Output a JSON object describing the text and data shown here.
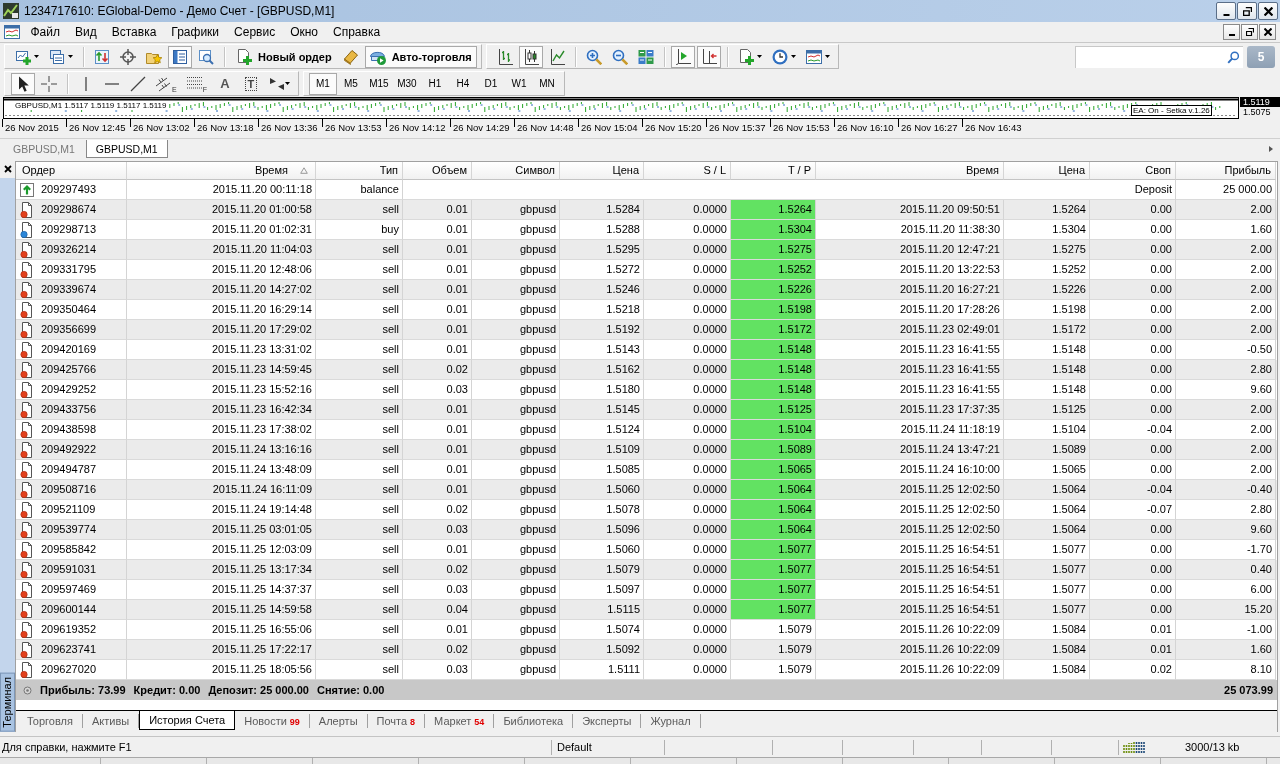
{
  "window": {
    "title": "1234717610: EGlobal-Demo - Демо Счет - [GBPUSD,M1]"
  },
  "menu": [
    "Файл",
    "Вид",
    "Вставка",
    "Графики",
    "Сервис",
    "Окно",
    "Справка"
  ],
  "toolbars": [
    {
      "groups": [
        [
          {
            "pressed": false
          },
          {
            "pressed": false
          }
        ],
        [
          {
            "pressed": false
          },
          {
            "pressed": false
          },
          {
            "pressed": false
          },
          {
            "pressed": true
          },
          {
            "pressed": false
          }
        ],
        [
          {
            "label": "Новый ордер",
            "pressed": false
          },
          {
            "pressed": false
          },
          {
            "label": "Авто-торговля",
            "pressed": true
          }
        ]
      ]
    },
    {
      "groups": [
        [
          {
            "pressed": false
          },
          {
            "pressed": true
          },
          {
            "pressed": false
          }
        ],
        [
          {
            "pressed": false
          },
          {
            "pressed": false
          },
          {
            "pressed": false
          }
        ],
        [
          {
            "pressed": true
          },
          {
            "pressed": true
          }
        ],
        [
          {
            "pressed": false
          },
          {
            "pressed": false
          },
          {
            "pressed": false
          }
        ]
      ]
    }
  ],
  "search": {
    "messages_count": "5"
  },
  "drawing_tools": {
    "groups": [
      [
        {
          "pressed": true
        },
        {
          "pressed": false
        }
      ],
      [
        {
          "pressed": false
        },
        {
          "pressed": false
        },
        {
          "pressed": false
        },
        {
          "label": "E",
          "pressed": false
        },
        {
          "label": "F",
          "pressed": false
        },
        {
          "label": "A",
          "pressed": false
        },
        {
          "label": "T",
          "pressed": false
        },
        {
          "pressed": false
        }
      ]
    ]
  },
  "timeframes": [
    {
      "label": "M1",
      "selected": true
    },
    {
      "label": "M5",
      "selected": false
    },
    {
      "label": "M15",
      "selected": false
    },
    {
      "label": "M30",
      "selected": false
    },
    {
      "label": "H1",
      "selected": false
    },
    {
      "label": "H4",
      "selected": false
    },
    {
      "label": "D1",
      "selected": false
    },
    {
      "label": "W1",
      "selected": false
    },
    {
      "label": "MN",
      "selected": false
    }
  ],
  "chart": {
    "header": "GBPUSD,M1  1.5117 1.5119 1.5117 1.5119",
    "ea_label": "EA: On - Setka v.1.26",
    "price_labels": [
      {
        "text": "1.5119",
        "current": true
      },
      {
        "text": "1.5075",
        "current": false
      }
    ],
    "time_labels": [
      "26 Nov 2015",
      "26 Nov 12:45",
      "26 Nov 13:02",
      "26 Nov 13:18",
      "26 Nov 13:36",
      "26 Nov 13:53",
      "26 Nov 14:12",
      "26 Nov 14:29",
      "26 Nov 14:48",
      "26 Nov 15:04",
      "26 Nov 15:20",
      "26 Nov 15:37",
      "26 Nov 15:53",
      "26 Nov 16:10",
      "26 Nov 16:27",
      "26 Nov 16:43"
    ]
  },
  "chart_tabs": [
    {
      "label": "GBPUSD,M1",
      "selected": false
    },
    {
      "label": "GBPUSD,M1",
      "selected": true
    }
  ],
  "terminal": {
    "label": "Терминал",
    "columns": [
      {
        "label": "Ордер",
        "sorted": false
      },
      {
        "label": "Время",
        "sorted": true
      },
      {
        "label": "Тип",
        "sorted": false
      },
      {
        "label": "Объем",
        "sorted": false
      },
      {
        "label": "Символ",
        "sorted": false
      },
      {
        "label": "Цена",
        "sorted": false
      },
      {
        "label": "S / L",
        "sorted": false
      },
      {
        "label": "T / P",
        "sorted": false
      },
      {
        "label": "Время",
        "sorted": false
      },
      {
        "label": "Цена",
        "sorted": false
      },
      {
        "label": "Своп",
        "sorted": false
      },
      {
        "label": "Прибыль",
        "sorted": false
      }
    ],
    "rows": [
      {
        "kind": "balance",
        "order": "209297493",
        "time": "2015.11.20 00:11:18",
        "type": "balance",
        "comment": "Deposit",
        "profit": "25 000.00"
      },
      {
        "kind": "sell",
        "order": "209298674",
        "time": "2015.11.20 01:00:58",
        "type": "sell",
        "volume": "0.01",
        "symbol": "gbpusd",
        "price": "1.5284",
        "sl": "0.0000",
        "tp": "1.5264",
        "tp_highlight": true,
        "close_time": "2015.11.20 09:50:51",
        "close_price": "1.5264",
        "swap": "0.00",
        "profit": "2.00"
      },
      {
        "kind": "buy",
        "order": "209298713",
        "time": "2015.11.20 01:02:31",
        "type": "buy",
        "volume": "0.01",
        "symbol": "gbpusd",
        "price": "1.5288",
        "sl": "0.0000",
        "tp": "1.5304",
        "tp_highlight": true,
        "close_time": "2015.11.20 11:38:30",
        "close_price": "1.5304",
        "swap": "0.00",
        "profit": "1.60"
      },
      {
        "kind": "sell",
        "order": "209326214",
        "time": "2015.11.20 11:04:03",
        "type": "sell",
        "volume": "0.01",
        "symbol": "gbpusd",
        "price": "1.5295",
        "sl": "0.0000",
        "tp": "1.5275",
        "tp_highlight": true,
        "close_time": "2015.11.20 12:47:21",
        "close_price": "1.5275",
        "swap": "0.00",
        "profit": "2.00"
      },
      {
        "kind": "sell",
        "order": "209331795",
        "time": "2015.11.20 12:48:06",
        "type": "sell",
        "volume": "0.01",
        "symbol": "gbpusd",
        "price": "1.5272",
        "sl": "0.0000",
        "tp": "1.5252",
        "tp_highlight": true,
        "close_time": "2015.11.20 13:22:53",
        "close_price": "1.5252",
        "swap": "0.00",
        "profit": "2.00"
      },
      {
        "kind": "sell",
        "order": "209339674",
        "time": "2015.11.20 14:27:02",
        "type": "sell",
        "volume": "0.01",
        "symbol": "gbpusd",
        "price": "1.5246",
        "sl": "0.0000",
        "tp": "1.5226",
        "tp_highlight": true,
        "close_time": "2015.11.20 16:27:21",
        "close_price": "1.5226",
        "swap": "0.00",
        "profit": "2.00"
      },
      {
        "kind": "sell",
        "order": "209350464",
        "time": "2015.11.20 16:29:14",
        "type": "sell",
        "volume": "0.01",
        "symbol": "gbpusd",
        "price": "1.5218",
        "sl": "0.0000",
        "tp": "1.5198",
        "tp_highlight": true,
        "close_time": "2015.11.20 17:28:26",
        "close_price": "1.5198",
        "swap": "0.00",
        "profit": "2.00"
      },
      {
        "kind": "sell",
        "order": "209356699",
        "time": "2015.11.20 17:29:02",
        "type": "sell",
        "volume": "0.01",
        "symbol": "gbpusd",
        "price": "1.5192",
        "sl": "0.0000",
        "tp": "1.5172",
        "tp_highlight": true,
        "close_time": "2015.11.23 02:49:01",
        "close_price": "1.5172",
        "swap": "0.00",
        "profit": "2.00"
      },
      {
        "kind": "sell",
        "order": "209420169",
        "time": "2015.11.23 13:31:02",
        "type": "sell",
        "volume": "0.01",
        "symbol": "gbpusd",
        "price": "1.5143",
        "sl": "0.0000",
        "tp": "1.5148",
        "tp_highlight": true,
        "close_time": "2015.11.23 16:41:55",
        "close_price": "1.5148",
        "swap": "0.00",
        "profit": "-0.50"
      },
      {
        "kind": "sell",
        "order": "209425766",
        "time": "2015.11.23 14:59:45",
        "type": "sell",
        "volume": "0.02",
        "symbol": "gbpusd",
        "price": "1.5162",
        "sl": "0.0000",
        "tp": "1.5148",
        "tp_highlight": true,
        "close_time": "2015.11.23 16:41:55",
        "close_price": "1.5148",
        "swap": "0.00",
        "profit": "2.80"
      },
      {
        "kind": "sell",
        "order": "209429252",
        "time": "2015.11.23 15:52:16",
        "type": "sell",
        "volume": "0.03",
        "symbol": "gbpusd",
        "price": "1.5180",
        "sl": "0.0000",
        "tp": "1.5148",
        "tp_highlight": true,
        "close_time": "2015.11.23 16:41:55",
        "close_price": "1.5148",
        "swap": "0.00",
        "profit": "9.60"
      },
      {
        "kind": "sell",
        "order": "209433756",
        "time": "2015.11.23 16:42:34",
        "type": "sell",
        "volume": "0.01",
        "symbol": "gbpusd",
        "price": "1.5145",
        "sl": "0.0000",
        "tp": "1.5125",
        "tp_highlight": true,
        "close_time": "2015.11.23 17:37:35",
        "close_price": "1.5125",
        "swap": "0.00",
        "profit": "2.00"
      },
      {
        "kind": "sell",
        "order": "209438598",
        "time": "2015.11.23 17:38:02",
        "type": "sell",
        "volume": "0.01",
        "symbol": "gbpusd",
        "price": "1.5124",
        "sl": "0.0000",
        "tp": "1.5104",
        "tp_highlight": true,
        "close_time": "2015.11.24 11:18:19",
        "close_price": "1.5104",
        "swap": "-0.04",
        "profit": "2.00"
      },
      {
        "kind": "sell",
        "order": "209492922",
        "time": "2015.11.24 13:16:16",
        "type": "sell",
        "volume": "0.01",
        "symbol": "gbpusd",
        "price": "1.5109",
        "sl": "0.0000",
        "tp": "1.5089",
        "tp_highlight": true,
        "close_time": "2015.11.24 13:47:21",
        "close_price": "1.5089",
        "swap": "0.00",
        "profit": "2.00"
      },
      {
        "kind": "sell",
        "order": "209494787",
        "time": "2015.11.24 13:48:09",
        "type": "sell",
        "volume": "0.01",
        "symbol": "gbpusd",
        "price": "1.5085",
        "sl": "0.0000",
        "tp": "1.5065",
        "tp_highlight": true,
        "close_time": "2015.11.24 16:10:00",
        "close_price": "1.5065",
        "swap": "0.00",
        "profit": "2.00"
      },
      {
        "kind": "sell",
        "order": "209508716",
        "time": "2015.11.24 16:11:09",
        "type": "sell",
        "volume": "0.01",
        "symbol": "gbpusd",
        "price": "1.5060",
        "sl": "0.0000",
        "tp": "1.5064",
        "tp_highlight": true,
        "close_time": "2015.11.25 12:02:50",
        "close_price": "1.5064",
        "swap": "-0.04",
        "profit": "-0.40"
      },
      {
        "kind": "sell",
        "order": "209521109",
        "time": "2015.11.24 19:14:48",
        "type": "sell",
        "volume": "0.02",
        "symbol": "gbpusd",
        "price": "1.5078",
        "sl": "0.0000",
        "tp": "1.5064",
        "tp_highlight": true,
        "close_time": "2015.11.25 12:02:50",
        "close_price": "1.5064",
        "swap": "-0.07",
        "profit": "2.80"
      },
      {
        "kind": "sell",
        "order": "209539774",
        "time": "2015.11.25 03:01:05",
        "type": "sell",
        "volume": "0.03",
        "symbol": "gbpusd",
        "price": "1.5096",
        "sl": "0.0000",
        "tp": "1.5064",
        "tp_highlight": true,
        "close_time": "2015.11.25 12:02:50",
        "close_price": "1.5064",
        "swap": "0.00",
        "profit": "9.60"
      },
      {
        "kind": "sell",
        "order": "209585842",
        "time": "2015.11.25 12:03:09",
        "type": "sell",
        "volume": "0.01",
        "symbol": "gbpusd",
        "price": "1.5060",
        "sl": "0.0000",
        "tp": "1.5077",
        "tp_highlight": true,
        "close_time": "2015.11.25 16:54:51",
        "close_price": "1.5077",
        "swap": "0.00",
        "profit": "-1.70"
      },
      {
        "kind": "sell",
        "order": "209591031",
        "time": "2015.11.25 13:17:34",
        "type": "sell",
        "volume": "0.02",
        "symbol": "gbpusd",
        "price": "1.5079",
        "sl": "0.0000",
        "tp": "1.5077",
        "tp_highlight": true,
        "close_time": "2015.11.25 16:54:51",
        "close_price": "1.5077",
        "swap": "0.00",
        "profit": "0.40"
      },
      {
        "kind": "sell",
        "order": "209597469",
        "time": "2015.11.25 14:37:37",
        "type": "sell",
        "volume": "0.03",
        "symbol": "gbpusd",
        "price": "1.5097",
        "sl": "0.0000",
        "tp": "1.5077",
        "tp_highlight": true,
        "close_time": "2015.11.25 16:54:51",
        "close_price": "1.5077",
        "swap": "0.00",
        "profit": "6.00"
      },
      {
        "kind": "sell",
        "order": "209600144",
        "time": "2015.11.25 14:59:58",
        "type": "sell",
        "volume": "0.04",
        "symbol": "gbpusd",
        "price": "1.5115",
        "sl": "0.0000",
        "tp": "1.5077",
        "tp_highlight": true,
        "close_time": "2015.11.25 16:54:51",
        "close_price": "1.5077",
        "swap": "0.00",
        "profit": "15.20"
      },
      {
        "kind": "sell",
        "order": "209619352",
        "time": "2015.11.25 16:55:06",
        "type": "sell",
        "volume": "0.01",
        "symbol": "gbpusd",
        "price": "1.5074",
        "sl": "0.0000",
        "tp": "1.5079",
        "tp_highlight": false,
        "close_time": "2015.11.26 10:22:09",
        "close_price": "1.5084",
        "swap": "0.01",
        "profit": "-1.00"
      },
      {
        "kind": "sell",
        "order": "209623741",
        "time": "2015.11.25 17:22:17",
        "type": "sell",
        "volume": "0.02",
        "symbol": "gbpusd",
        "price": "1.5092",
        "sl": "0.0000",
        "tp": "1.5079",
        "tp_highlight": false,
        "close_time": "2015.11.26 10:22:09",
        "close_price": "1.5084",
        "swap": "0.01",
        "profit": "1.60"
      },
      {
        "kind": "sell",
        "order": "209627020",
        "time": "2015.11.25 18:05:56",
        "type": "sell",
        "volume": "0.03",
        "symbol": "gbpusd",
        "price": "1.5111",
        "sl": "0.0000",
        "tp": "1.5079",
        "tp_highlight": false,
        "close_time": "2015.11.26 10:22:09",
        "close_price": "1.5084",
        "swap": "0.02",
        "profit": "8.10"
      }
    ],
    "summary": {
      "items": [
        "Прибыль: 73.99",
        "Кредит: 0.00",
        "Депозит: 25 000.00",
        "Снятие: 0.00"
      ],
      "total": "25 073.99"
    },
    "tabs": [
      {
        "label": "Торговля",
        "selected": false
      },
      {
        "label": "Активы",
        "selected": false
      },
      {
        "label": "История Счета",
        "selected": true
      },
      {
        "label": "Новости",
        "badge": "99",
        "selected": false
      },
      {
        "label": "Алерты",
        "selected": false
      },
      {
        "label": "Почта",
        "badge": "8",
        "selected": false
      },
      {
        "label": "Маркет",
        "badge": "54",
        "selected": false
      },
      {
        "label": "Библиотека",
        "selected": false
      },
      {
        "label": "Эксперты",
        "selected": false
      },
      {
        "label": "Журнал",
        "selected": false
      }
    ]
  },
  "status_bar": {
    "help": "Для справки, нажмите F1",
    "profile": "Default",
    "traffic": "3000/13 kb"
  }
}
